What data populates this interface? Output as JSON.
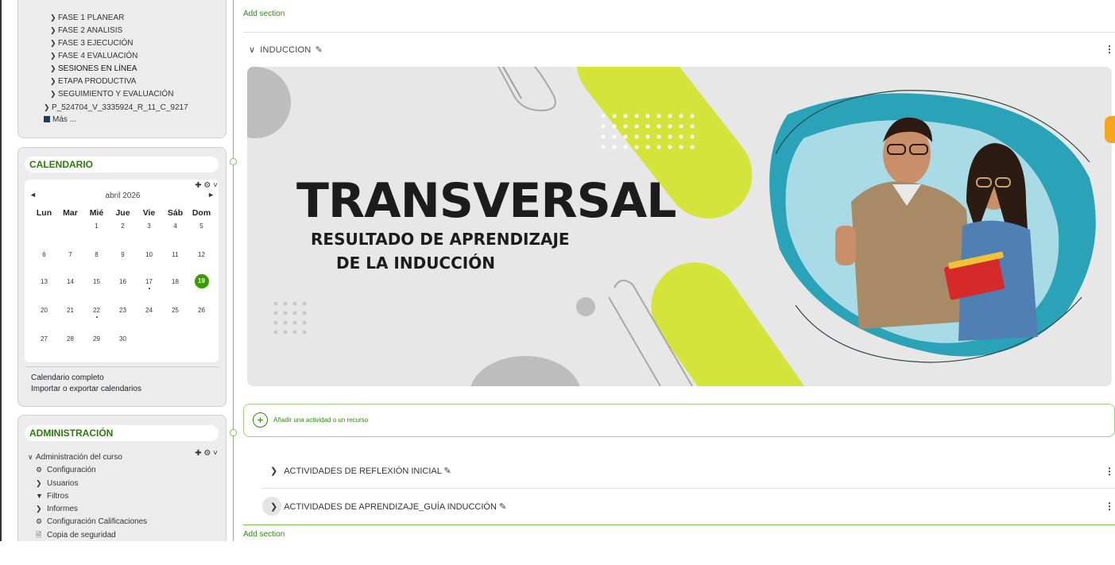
{
  "nav": {
    "items": [
      {
        "label": "FASE 1 PLANEAR",
        "icon": "chevron-right-icon"
      },
      {
        "label": "FASE 2 ANALISIS",
        "icon": "chevron-right-icon"
      },
      {
        "label": "FASE 3 EJECUCIÓN",
        "icon": "chevron-right-icon"
      },
      {
        "label": "FASE 4 EVALUACIÓN",
        "icon": "chevron-right-icon"
      },
      {
        "label": "SESIONES EN LÍNEA",
        "icon": "chevron-right-icon"
      },
      {
        "label": "ETAPA PRODUCTIVA",
        "icon": "chevron-right-icon"
      },
      {
        "label": "SEGUIMIENTO Y EVALUACIÓN",
        "icon": "chevron-right-icon"
      },
      {
        "label": "P_524704_V_3335924_R_11_C_9217",
        "icon": "chevron-right-icon"
      },
      {
        "label": "Más ...",
        "icon": "square-icon"
      }
    ]
  },
  "calendar": {
    "title": "CALENDARIO",
    "prev_glyph": "◄",
    "next_glyph": "►",
    "month": "abril 2026",
    "weekdays": [
      "Lun",
      "Mar",
      "Mié",
      "Jue",
      "Vie",
      "Sáb",
      "Dom"
    ],
    "weeks": [
      [
        "",
        "",
        "1",
        "2",
        "3",
        "4",
        "5"
      ],
      [
        "6",
        "7",
        "8",
        "9",
        "10",
        "11",
        "12"
      ],
      [
        "13",
        "14",
        "15",
        "16",
        "17",
        "18",
        "19"
      ],
      [
        "20",
        "21",
        "22",
        "23",
        "24",
        "25",
        "26"
      ],
      [
        "27",
        "28",
        "29",
        "30",
        "",
        "",
        ""
      ]
    ],
    "today": "19",
    "event_days": [
      "17",
      "22"
    ],
    "full_link": "Calendario completo",
    "export_link": "Importar o exportar calendarios",
    "today_color": "#399b00"
  },
  "admin": {
    "title": "ADMINISTRACIÓN",
    "items": [
      {
        "label": "Administración del curso",
        "icon": "chevron-down-icon"
      },
      {
        "label": "Configuración",
        "icon": "gear-icon"
      },
      {
        "label": "Usuarios",
        "icon": "chevron-right-icon"
      },
      {
        "label": "Filtros",
        "icon": "filter-icon"
      },
      {
        "label": "Informes",
        "icon": "chevron-right-icon"
      },
      {
        "label": "Configuración Calificaciones",
        "icon": "gear-icon"
      },
      {
        "label": "Copia de seguridad",
        "icon": "document-icon"
      }
    ]
  },
  "main": {
    "add_section_top": "Add section",
    "add_section_bottom": "Add section",
    "section_title": "INDUCCION",
    "banner": {
      "title": "TRANSVERSAL",
      "subtitle_line1": "RESULTADO DE APRENDIZAJE",
      "subtitle_line2": "DE LA INDUCCIÓN",
      "accent_color": "#d4e43a",
      "teal_color": "#2aa3b8"
    },
    "add_activity": "Añadir una actividad o un recurso",
    "subsections": [
      "ACTIVIDADES DE REFLEXIÓN INICIAL",
      "ACTIVIDADES DE APRENDIZAJE_GUÍA INDUCCIÓN"
    ]
  },
  "colors": {
    "brand_green": "#2b8a0b",
    "timeline_green": "#7ac943"
  }
}
